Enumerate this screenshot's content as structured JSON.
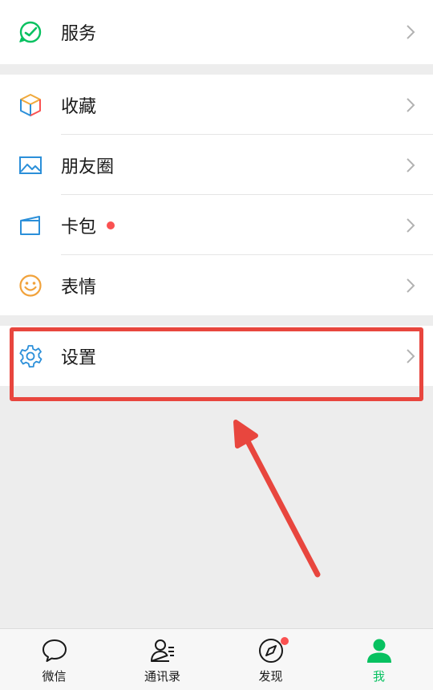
{
  "menu": {
    "services": {
      "label": "服务",
      "icon": "services-check-icon",
      "color": "#07c160"
    },
    "favorites": {
      "label": "收藏",
      "icon": "cube-icon"
    },
    "moments": {
      "label": "朋友圈",
      "icon": "picture-icon",
      "color": "#2b8fd9"
    },
    "cards": {
      "label": "卡包",
      "icon": "wallet-card-icon",
      "badge_color": "#fa5151"
    },
    "stickers": {
      "label": "表情",
      "icon": "smiley-icon",
      "color": "#f1a23b"
    },
    "settings": {
      "label": "设置",
      "icon": "gear-icon",
      "color": "#2b8fd9"
    }
  },
  "annotation": {
    "color": "#e8463e"
  },
  "tabbar": {
    "tabs": [
      {
        "label": "微信",
        "icon": "chat-bubble-icon"
      },
      {
        "label": "通讯录",
        "icon": "contacts-icon"
      },
      {
        "label": "发现",
        "icon": "compass-icon",
        "badge_color": "#fa5151"
      },
      {
        "label": "我",
        "icon": "person-icon",
        "active": true,
        "color": "#07c160"
      }
    ]
  }
}
